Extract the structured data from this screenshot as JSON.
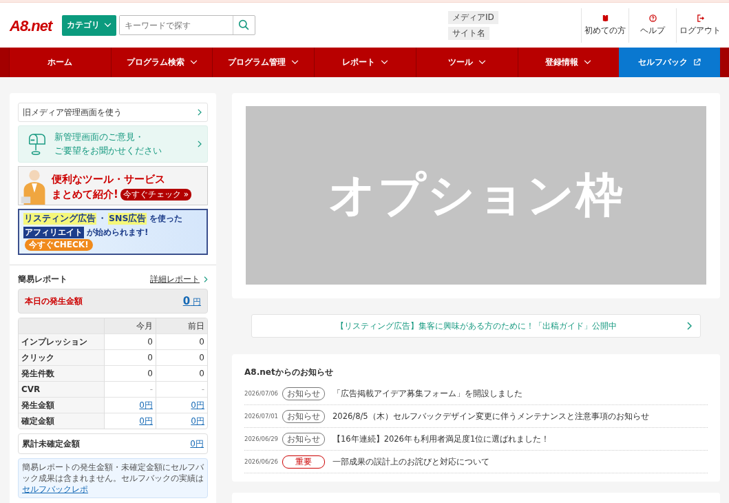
{
  "header": {
    "logo": "A8.net",
    "category_button": "カテゴリ",
    "search": {
      "placeholder": "キーワードで探す"
    },
    "media_id": "メディアID",
    "site_name": "サイト名",
    "actions": [
      {
        "kind": "guide",
        "label": "初めての方"
      },
      {
        "kind": "help",
        "label": "ヘルプ"
      },
      {
        "kind": "logout",
        "label": "ログアウト"
      }
    ]
  },
  "nav": [
    {
      "label": "ホーム",
      "kind": "plain"
    },
    {
      "label": "プログラム検索",
      "kind": "dropdown"
    },
    {
      "label": "プログラム管理",
      "kind": "dropdown"
    },
    {
      "label": "レポート",
      "kind": "dropdown"
    },
    {
      "label": "ツール",
      "kind": "dropdown"
    },
    {
      "label": "登録情報",
      "kind": "dropdown"
    },
    {
      "label": "セルフバック",
      "kind": "external"
    }
  ],
  "sidebar": {
    "old_screen_link": "旧メディア管理画面を使う",
    "feedback": [
      "新管理画面のご意見・",
      "ご要望をお聞かせください"
    ],
    "banner_tools": {
      "lines": [
        "便利なツール・サービス",
        "まとめて紹介!"
      ],
      "button": "今すぐチェック »"
    },
    "banner_listing": {
      "highlight_1": "リスティング広告",
      "mid": "・",
      "highlight_2": "SNS広告",
      "tail_1": "を使った",
      "highlight_3": "アフィリエイト",
      "tail_2": "が始められます!",
      "button": "今すぐCHECK!"
    },
    "report": {
      "title": "簡易レポート",
      "detail_link": "詳細レポート",
      "today_label": "本日の発生金額",
      "today_value": "0",
      "today_unit": "円",
      "columns": [
        "今月",
        "前日"
      ],
      "rows": [
        {
          "label": "インプレッション",
          "values": [
            "0",
            "0"
          ],
          "kind": "plain"
        },
        {
          "label": "クリック",
          "values": [
            "0",
            "0"
          ],
          "kind": "plain"
        },
        {
          "label": "発生件数",
          "values": [
            "0",
            "0"
          ],
          "kind": "plain"
        },
        {
          "label": "CVR",
          "values": [
            "-",
            "-"
          ],
          "kind": "muted"
        },
        {
          "label": "発生金額",
          "values": [
            "0円",
            "0円"
          ],
          "kind": "link"
        },
        {
          "label": "確定金額",
          "values": [
            "0円",
            "0円"
          ],
          "kind": "link"
        }
      ],
      "pending_label": "累計未確定金額",
      "pending_value": "0円",
      "note": "簡易レポートの発生金額・未確定金額にセルフバック成果は含まれません。セルフバックの実績は ",
      "note_link": "セルフバックレポ"
    }
  },
  "option_frame": "オプション枠",
  "listing_notice": "【リスティング広告】集客に興味がある方のために！「出稿ガイド」公開中",
  "news": {
    "title": "A8.netからのお知らせ",
    "items": [
      {
        "date": "2026/07/06",
        "tag": "お知らせ",
        "kind": "info",
        "text": "「広告掲載アイデア募集フォーム」を開設しました"
      },
      {
        "date": "2026/07/01",
        "tag": "お知らせ",
        "kind": "info",
        "text": "2026/8/5（木）セルフバックデザイン変更に伴うメンテナンスと注意事項のお知らせ"
      },
      {
        "date": "2026/06/29",
        "tag": "お知らせ",
        "kind": "info",
        "text": "【16年連続】2026年も利用者満足度1位に選ばれました！"
      },
      {
        "date": "2026/06/26",
        "tag": "重要",
        "kind": "important",
        "text": "一部成果の誤計上のお詫びと対応について"
      }
    ]
  }
}
